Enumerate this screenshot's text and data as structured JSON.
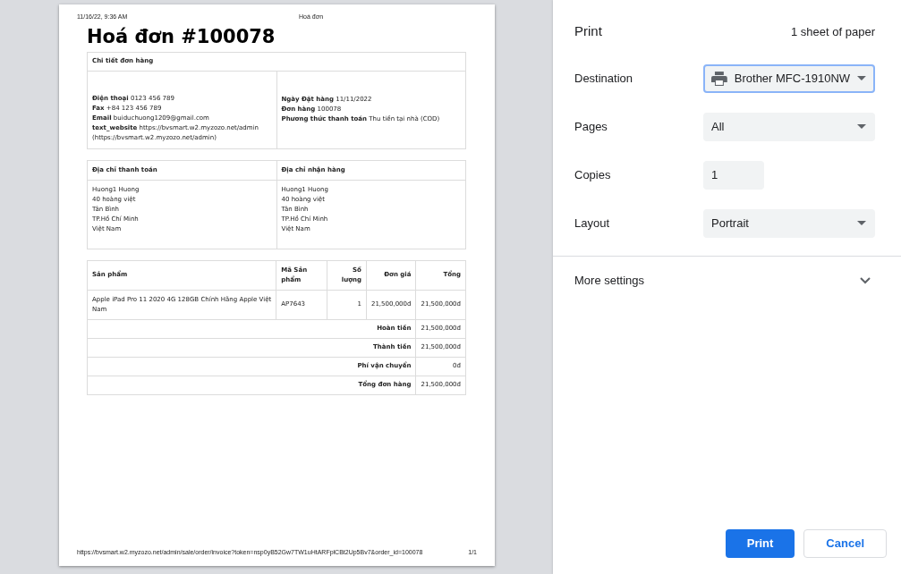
{
  "preview": {
    "header_date": "11/16/22, 9:36 AM",
    "header_title": "Hoá đơn",
    "title": "Hoá đơn #100078",
    "details": {
      "heading": "Chi tiết đơn hàng",
      "left_lines": [
        "**Điện thoại** 0123 456 789",
        "**Fax** +84 123 456 789",
        "**Email** buiduchuong1209@gmail.com",
        "**text_website** https://bvsmart.w2.myzozo.net/admin (https://bvsmart.w2.myzozo.net/admin)"
      ],
      "right_lines": [
        "**Ngày Đặt hàng** 11/11/2022",
        "**Đơn hàng** 100078",
        "**Phương thức thanh toán** Thu tiền tại nhà (COD)"
      ]
    },
    "addresses": [
      {
        "heading": "Địa chỉ thanh toán",
        "lines": [
          "Huong1 Huong",
          "40 hoàng việt",
          "Tân Bình",
          "TP.Hồ Chí Minh",
          "Việt Nam"
        ]
      },
      {
        "heading": "Địa chỉ nhận hàng",
        "lines": [
          "Huong1 Huong",
          "40 hoàng việt",
          "Tân Bình",
          "TP.Hồ Chí Minh",
          "Việt Nam"
        ]
      }
    ],
    "items_table": {
      "columns": [
        "Sản phẩm",
        "Mã Sản phẩm",
        "Số lượng",
        "Đơn giá",
        "Tổng"
      ],
      "rows": [
        [
          "Apple iPad Pro 11 2020 4G 128GB Chính Hãng Apple Việt Nam",
          "AP7643",
          "1",
          "21,500,000đ",
          "21,500,000đ"
        ]
      ],
      "totals": [
        {
          "label": "Hoàn tiền",
          "value": "21,500,000đ"
        },
        {
          "label": "Thành tiền",
          "value": "21,500,000đ"
        },
        {
          "label": "Phí vận chuyển",
          "value": "0đ"
        },
        {
          "label": "Tổng đơn hàng",
          "value": "21,500,000đ"
        }
      ]
    },
    "footer_url": "https://bvsmart.w2.myzozo.net/admin/sale/order/invoice?token=nsp0yB52Gw7TW1uHtARFplCBt2Up5Bv7&order_id=100078",
    "footer_page": "1/1"
  },
  "settings": {
    "title": "Print",
    "sheets": "1 sheet of paper",
    "fields": [
      {
        "label": "Destination",
        "kind": "select",
        "value": "Brother MFC-1910NW",
        "focused": true,
        "printer": true
      },
      {
        "label": "Pages",
        "kind": "select",
        "value": "All",
        "focused": false,
        "printer": false
      },
      {
        "label": "Copies",
        "kind": "input",
        "value": "1",
        "focused": false,
        "printer": false
      },
      {
        "label": "Layout",
        "kind": "select",
        "value": "Portrait",
        "focused": false,
        "printer": false
      }
    ],
    "more_settings": {
      "label": "More settings",
      "expanded": false
    },
    "buttons": [
      {
        "label": "Print",
        "kind": "primary"
      },
      {
        "label": "Cancel",
        "kind": "secondary"
      }
    ]
  }
}
